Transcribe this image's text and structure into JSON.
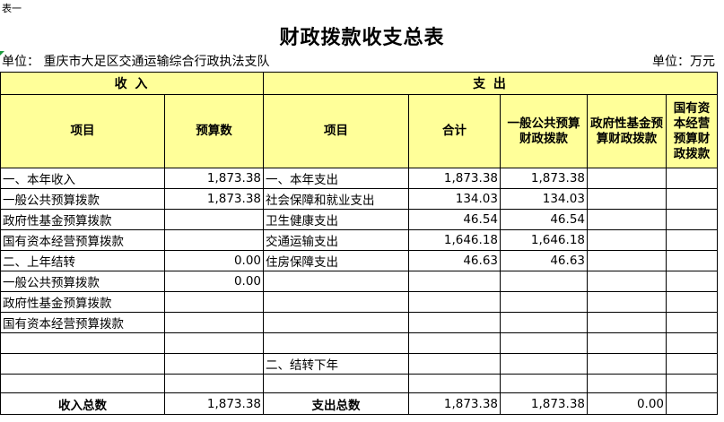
{
  "corner_label": "表一",
  "title": "财政拨款收支总表",
  "unit_left": "单位：  重庆市大足区交通运输综合行政执法支队",
  "unit_right": "单位：万元",
  "sections": {
    "income": "收 入",
    "expense": "支 出"
  },
  "headers": {
    "income_item": "项目",
    "income_budget": "预算数",
    "expense_item": "项目",
    "expense_total": "合计",
    "general_budget": "一般公共预算财政拨款",
    "gov_fund": "政府性基金预算财政拨款",
    "state_capital": "国有资本经营预算财政拨款"
  },
  "rows": [
    {
      "income_item": "一、本年收入",
      "income_value": "1,873.38",
      "expense_item": "一、本年支出",
      "expense_total": "1,873.38",
      "general": "1,873.38",
      "gov_fund": "",
      "state_capital": ""
    },
    {
      "income_item": "一般公共预算拨款",
      "income_value": "1,873.38",
      "expense_item": "社会保障和就业支出",
      "expense_total": "134.03",
      "general": "134.03",
      "gov_fund": "",
      "state_capital": ""
    },
    {
      "income_item": "政府性基金预算拨款",
      "income_value": "",
      "expense_item": "卫生健康支出",
      "expense_total": "46.54",
      "general": "46.54",
      "gov_fund": "",
      "state_capital": ""
    },
    {
      "income_item": "国有资本经营预算拨款",
      "income_value": "",
      "expense_item": "交通运输支出",
      "expense_total": "1,646.18",
      "general": "1,646.18",
      "gov_fund": "",
      "state_capital": ""
    },
    {
      "income_item": "二、上年结转",
      "income_value": "0.00",
      "expense_item": "住房保障支出",
      "expense_total": "46.63",
      "general": "46.63",
      "gov_fund": "",
      "state_capital": ""
    },
    {
      "income_item": "一般公共预算拨款",
      "income_value": "0.00",
      "expense_item": "",
      "expense_total": "",
      "general": "",
      "gov_fund": "",
      "state_capital": ""
    },
    {
      "income_item": "政府性基金预算拨款",
      "income_value": "",
      "expense_item": "",
      "expense_total": "",
      "general": "",
      "gov_fund": "",
      "state_capital": ""
    },
    {
      "income_item": "国有资本经营预算拨款",
      "income_value": "",
      "expense_item": "",
      "expense_total": "",
      "general": "",
      "gov_fund": "",
      "state_capital": ""
    },
    {
      "income_item": "",
      "income_value": "",
      "expense_item": "",
      "expense_total": "",
      "general": "",
      "gov_fund": "",
      "state_capital": ""
    },
    {
      "income_item": "",
      "income_value": "",
      "expense_item": "二、结转下年",
      "expense_total": "",
      "general": "",
      "gov_fund": "",
      "state_capital": ""
    },
    {
      "income_item": "",
      "income_value": "",
      "expense_item": "",
      "expense_total": "",
      "general": "",
      "gov_fund": "",
      "state_capital": ""
    }
  ],
  "totals": {
    "income_label": "收入总数",
    "income_value": "1,873.38",
    "expense_label": "支出总数",
    "expense_total": "1,873.38",
    "general": "1,873.38",
    "gov_fund": "0.00",
    "state_capital": ""
  },
  "colors": {
    "header_fill": "#ffff99",
    "marker": "#1c9a3e"
  }
}
